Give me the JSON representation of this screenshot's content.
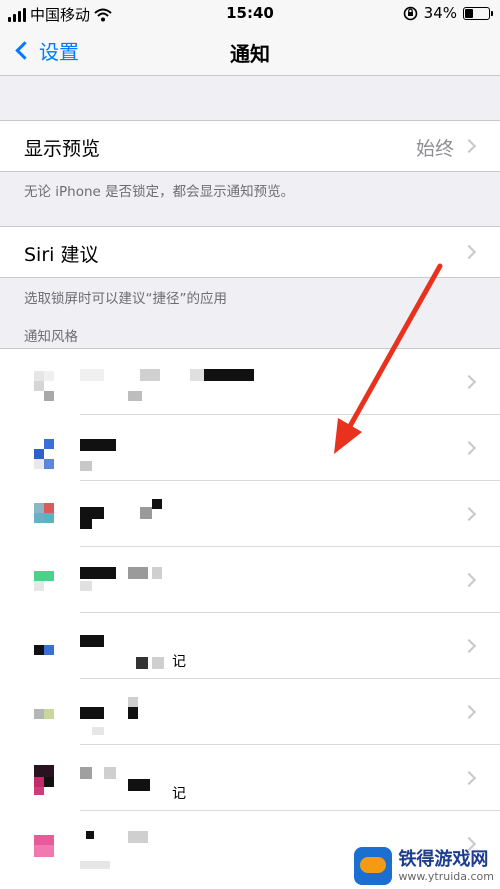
{
  "status_bar": {
    "carrier": "中国移动",
    "time": "15:40",
    "battery_percent": "34%",
    "battery_level": 0.34,
    "icons": [
      "signal-icon",
      "wifi-icon",
      "rotation-lock-icon",
      "battery-icon"
    ]
  },
  "nav": {
    "back_label": "设置",
    "title": "通知"
  },
  "show_preview": {
    "label": "显示预览",
    "value": "始终",
    "footer": "无论 iPhone 是否锁定，都会显示通知预览。"
  },
  "siri": {
    "label": "Siri 建议",
    "footer": "选取锁屏时可以建议“捷径”的应用"
  },
  "notification_style": {
    "header": "通知风格",
    "apps": [
      {
        "name_suffix": ""
      },
      {
        "name_suffix": ""
      },
      {
        "name_suffix": ""
      },
      {
        "name_suffix": ""
      },
      {
        "name_suffix": "记"
      },
      {
        "name_suffix": ""
      },
      {
        "name_suffix": "记"
      },
      {
        "name_suffix": ""
      }
    ]
  },
  "watermark": {
    "title": "铁得游戏网",
    "url": "www.ytruida.com"
  },
  "colors": {
    "accent": "#007aff",
    "arrow": "#e8321e",
    "background": "#efeff4"
  }
}
